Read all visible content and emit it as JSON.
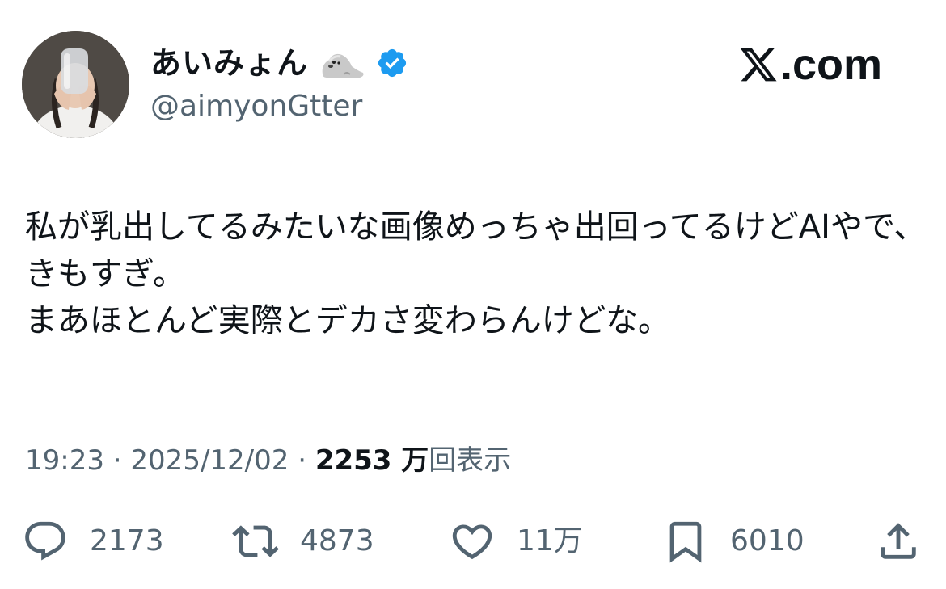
{
  "user": {
    "display_name": "あいみょん",
    "name_emoji": "seal-emoji-icon",
    "verified_badge": "verified-badge-icon",
    "verified_color": "#1d9bf0",
    "handle": "@aimyonGtter"
  },
  "brand": {
    "logo": "x-logo-icon",
    "domain_suffix": ".com"
  },
  "tweet": {
    "text": "私が乳出してるみたいな画像めっちゃ出回ってるけどAIやで、きもすぎ。\nまあほとんど実際とデカさ変わらんけどな。"
  },
  "meta": {
    "time": "19:23",
    "sep1": " · ",
    "date": "2025/12/02",
    "sep2": " · ",
    "views_count": "2253 万",
    "views_label": "回表示"
  },
  "actions": {
    "reply_count": "2173",
    "repost_count": "4873",
    "like_count": "11万",
    "bookmark_count": "6010"
  },
  "colors": {
    "text_primary": "#0f1419",
    "text_secondary": "#536471",
    "background": "#ffffff"
  }
}
